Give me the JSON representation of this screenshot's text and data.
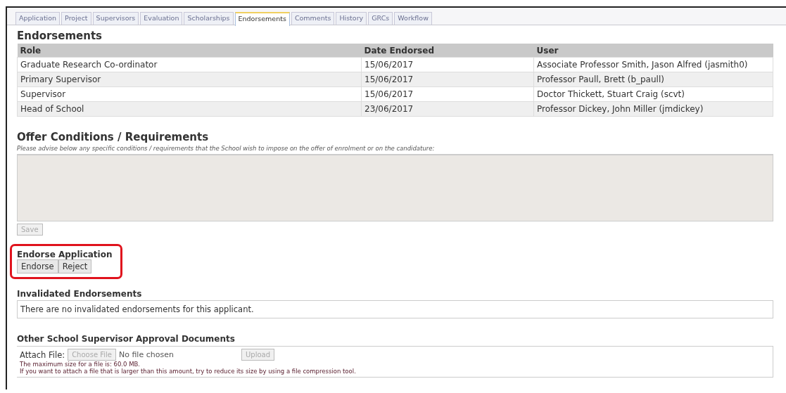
{
  "tabs": [
    {
      "label": "Application",
      "selected": false
    },
    {
      "label": "Project",
      "selected": false
    },
    {
      "label": "Supervisors",
      "selected": false
    },
    {
      "label": "Evaluation",
      "selected": false
    },
    {
      "label": "Scholarships",
      "selected": false
    },
    {
      "label": "Endorsements",
      "selected": true
    },
    {
      "label": "Comments",
      "selected": false
    },
    {
      "label": "History",
      "selected": false
    },
    {
      "label": "GRCs",
      "selected": false
    },
    {
      "label": "Workflow",
      "selected": false
    }
  ],
  "endorsements": {
    "title": "Endorsements",
    "columns": [
      "Role",
      "Date Endorsed",
      "User"
    ],
    "rows": [
      [
        "Graduate Research Co-ordinator",
        "15/06/2017",
        "Associate Professor Smith, Jason Alfred (jasmith0)"
      ],
      [
        "Primary Supervisor",
        "15/06/2017",
        "Professor Paull, Brett (b_paull)"
      ],
      [
        "Supervisor",
        "15/06/2017",
        "Doctor Thickett, Stuart Craig (scvt)"
      ],
      [
        "Head of School",
        "23/06/2017",
        "Professor Dickey, John Miller (jmdickey)"
      ]
    ]
  },
  "offer_conditions": {
    "title": "Offer Conditions / Requirements",
    "hint": "Please advise below any specific conditions / requirements that the School wish to impose on the offer of enrolment or on the candidature:",
    "disabled": true,
    "save_button": {
      "label": "Save",
      "disabled": true
    }
  },
  "endorse_application": {
    "title": "Endorse Application",
    "highlighted": true,
    "buttons": [
      {
        "label": "Endorse",
        "disabled": false
      },
      {
        "label": "Reject",
        "disabled": false
      }
    ]
  },
  "invalidated_endorsements": {
    "title": "Invalidated Endorsements",
    "message": "There are no invalidated endorsements for this applicant."
  },
  "approval_documents": {
    "title": "Other School Supervisor Approval Documents",
    "attach_label": "Attach File:",
    "choose_button": {
      "label": "Choose File",
      "disabled": true
    },
    "file_status": "No file chosen",
    "upload_button": {
      "label": "Upload",
      "disabled": true
    },
    "notes": [
      "The maximum size for a file is: 60.0 MB.",
      "If you want to attach a file that is larger than this amount, try to reduce its size by using a file compression tool."
    ]
  }
}
